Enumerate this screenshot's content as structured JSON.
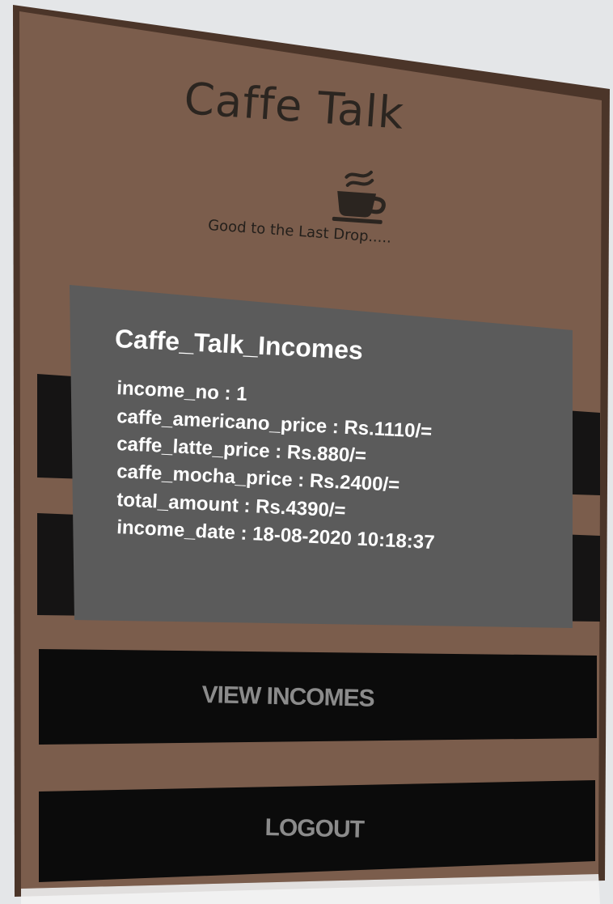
{
  "app": {
    "title": "Caffe Talk",
    "tagline": "Good to the Last Drop....."
  },
  "icons": {
    "logo": "coffee-cup-icon"
  },
  "dialog": {
    "title": "Caffe_Talk_Incomes",
    "lines": [
      "income_no : 1",
      "caffe_americano_price : Rs.1110/=",
      "caffe_latte_price : Rs.880/=",
      "caffe_mocha_price : Rs.2400/=",
      "total_amount : Rs.4390/=",
      "income_date : 18-08-2020 10:18:37"
    ]
  },
  "buttons": {
    "view_incomes": "VIEW INCOMES",
    "logout": "LOGOUT"
  },
  "colors": {
    "background": "#7b5d4c",
    "dialog": "#5a5a5a",
    "button": "#0a0a0a",
    "button_text": "#8b8b8b"
  }
}
